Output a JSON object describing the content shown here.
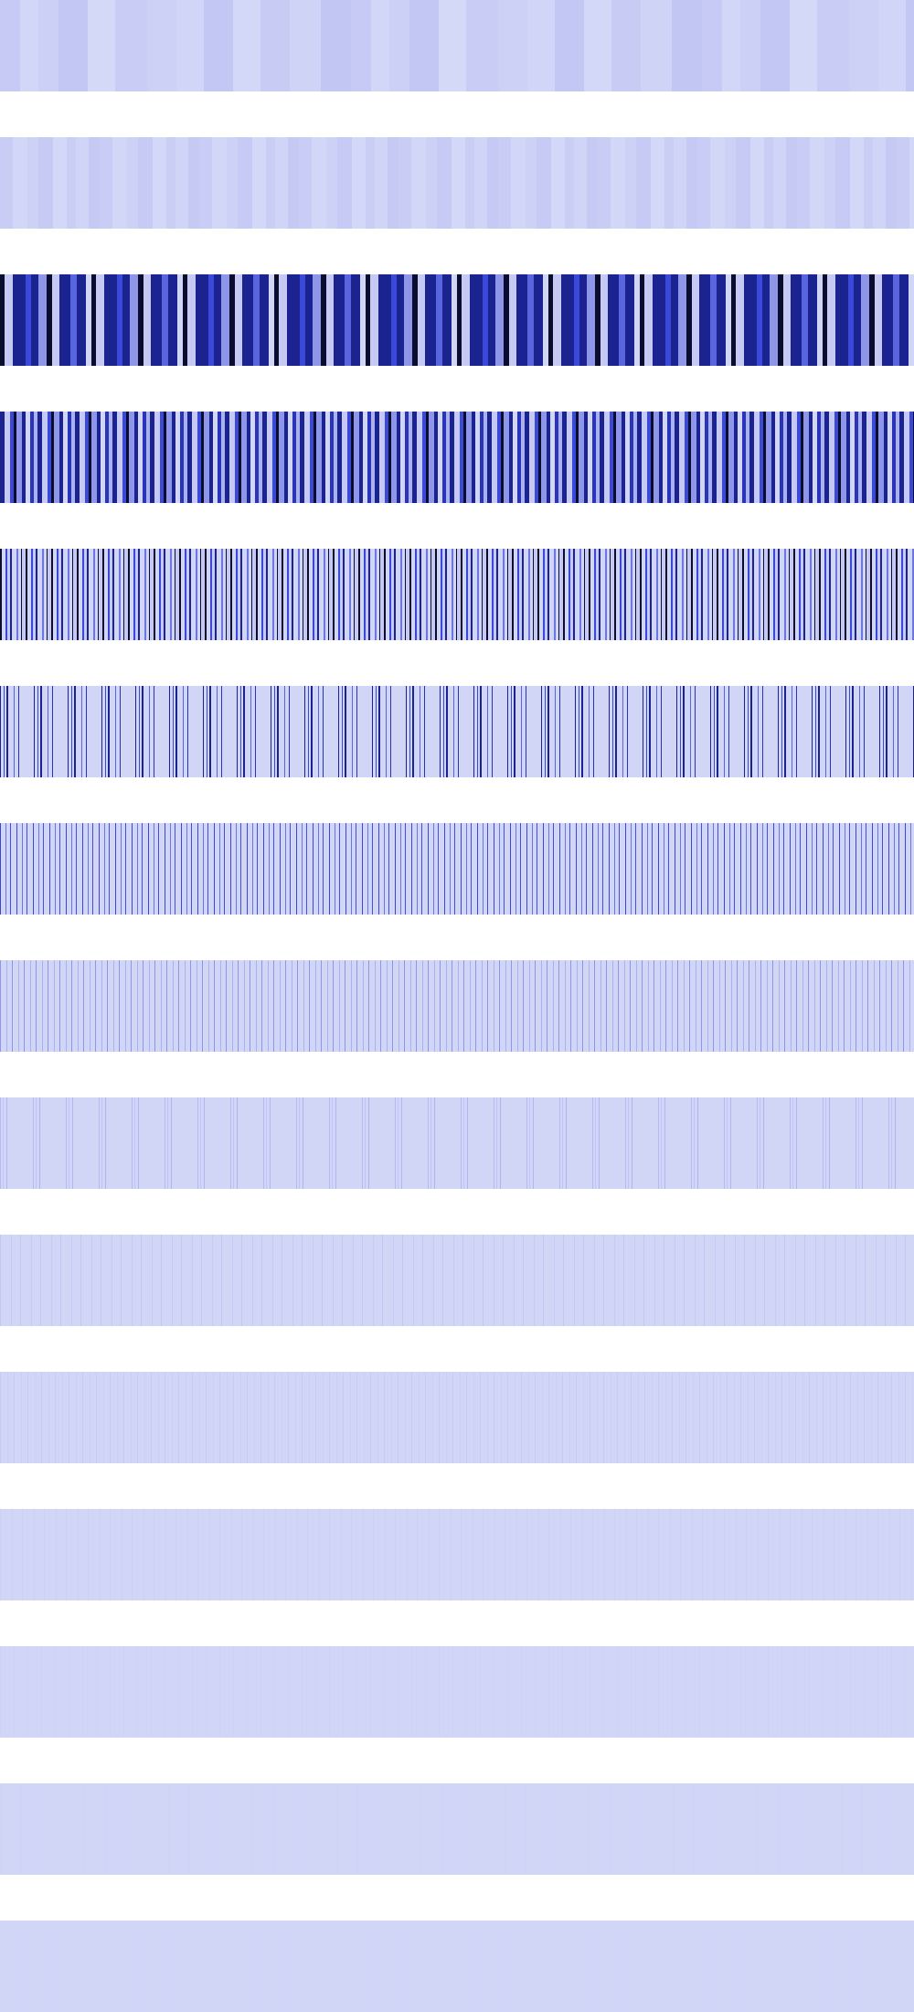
{
  "palette": {
    "background": "#ffffff",
    "base_light": "#d1d5f6",
    "lavender": "#c5c9f3",
    "periwinkle": "#8d96e8",
    "blue": "#3a49d8",
    "navy": "#1b2390",
    "near_black": "#0b0d2e"
  },
  "bands": [
    {
      "name": "band-01",
      "base": "#d1d5f6",
      "pattern": [
        [
          "#c6caf4",
          22
        ],
        [
          "#d2d6f7",
          20
        ],
        [
          "#ccd0f6",
          22
        ],
        [
          "#c3c7f3",
          32
        ],
        [
          "#d5d9f8",
          30
        ],
        [
          "#c9cdf5",
          35
        ],
        [
          "#cdd1f6",
          32
        ],
        [
          "#d1d5f7",
          30
        ],
        [
          "#c3c7f4",
          32
        ],
        [
          "#d4d8f8",
          30
        ],
        [
          "#c8ccf5",
          32
        ],
        [
          "#cfd3f6",
          34
        ],
        [
          "#c2c6f3",
          33
        ]
      ]
    },
    {
      "name": "band-02",
      "base": "#d1d5f6",
      "pattern": [
        [
          "#c9cdf5",
          14
        ],
        [
          "#d3d7f7",
          16
        ],
        [
          "#cdd1f6",
          12
        ],
        [
          "#c6caf4",
          16
        ],
        [
          "#d4d8f8",
          15
        ],
        [
          "#cacef5",
          10
        ],
        [
          "#d0d4f7",
          14
        ],
        [
          "#c5c9f3",
          12
        ]
      ]
    },
    {
      "name": "band-03",
      "base": "#d1d5f6",
      "pattern": [
        [
          "#0b0d2e",
          5
        ],
        [
          "#c5c9f3",
          9
        ],
        [
          "#1b2390",
          14
        ],
        [
          "#3a49d8",
          6
        ],
        [
          "#1b2390",
          8
        ],
        [
          "#8d96e8",
          9
        ],
        [
          "#0b0d2e",
          6
        ],
        [
          "#c5c9f3",
          8
        ],
        [
          "#1b2390",
          12
        ],
        [
          "#5865df",
          7
        ],
        [
          "#1b2390",
          10
        ],
        [
          "#d1d5f6",
          6
        ]
      ]
    },
    {
      "name": "band-04",
      "base": "#d1d5f6",
      "pattern": [
        [
          "#1b2390",
          5
        ],
        [
          "#c5c9f3",
          6
        ],
        [
          "#3a49d8",
          4
        ],
        [
          "#0b0d2e",
          3
        ],
        [
          "#8d96e8",
          6
        ],
        [
          "#1b2390",
          4
        ],
        [
          "#d1d5f6",
          5
        ],
        [
          "#2a34b8",
          4
        ],
        [
          "#aab1ef",
          4
        ]
      ]
    },
    {
      "name": "band-05",
      "base": "#d1d5f6",
      "pattern": [
        [
          "#0b0d2e",
          2
        ],
        [
          "#d1d5f6",
          4
        ],
        [
          "#3a49d8",
          2
        ],
        [
          "#c5c9f3",
          3
        ],
        [
          "#1b2390",
          2
        ],
        [
          "#d1d5f6",
          5
        ],
        [
          "#6c76e2",
          2
        ],
        [
          "#d1d5f6",
          3
        ],
        [
          "#0b0d2e",
          1
        ],
        [
          "#c5c9f3",
          4
        ]
      ]
    },
    {
      "name": "band-06",
      "base": "#d1d5f6",
      "pattern": [
        [
          "#1b2390",
          1
        ],
        [
          "#d1d5f6",
          3
        ],
        [
          "#3a49d8",
          1
        ],
        [
          "#d1d5f6",
          2
        ],
        [
          "#1b2390",
          2
        ],
        [
          "#d1d5f6",
          6
        ],
        [
          "#5865df",
          1
        ],
        [
          "#d1d5f6",
          4
        ],
        [
          "#2a34b8",
          1
        ],
        [
          "#d1d5f6",
          16
        ]
      ]
    },
    {
      "name": "band-07",
      "base": "#d1d5f6",
      "pattern": [
        [
          "#3a49d8",
          1
        ],
        [
          "#d1d5f6",
          5
        ],
        [
          "#6c76e2",
          1
        ],
        [
          "#d1d5f6",
          4
        ],
        [
          "#4250db",
          1
        ],
        [
          "#d1d5f6",
          6
        ]
      ]
    },
    {
      "name": "band-08",
      "base": "#d1d5f6",
      "pattern": [
        [
          "#8d96e8",
          1
        ],
        [
          "#d1d5f6",
          6
        ],
        [
          "#aab1ef",
          1
        ],
        [
          "#d1d5f6",
          5
        ]
      ]
    },
    {
      "name": "band-09",
      "base": "#d1d5f6",
      "pattern": [
        [
          "#b5bbf1",
          1
        ],
        [
          "#d1d5f6",
          2
        ],
        [
          "#c0c5f3",
          1
        ],
        [
          "#d1d5f6",
          3
        ],
        [
          "#b0b6f0",
          1
        ],
        [
          "#d1d5f6",
          28
        ]
      ]
    },
    {
      "name": "band-10",
      "base": "#d1d5f6",
      "pattern": [
        [
          "#c2c7f4",
          1
        ],
        [
          "#d1d5f6",
          11
        ],
        [
          "#c6cbf5",
          1
        ],
        [
          "#d1d5f6",
          9
        ]
      ]
    },
    {
      "name": "band-11",
      "base": "#d1d5f6",
      "pattern": [
        [
          "#c8ccf5",
          1
        ],
        [
          "#d1d5f6",
          7
        ],
        [
          "#cbcff6",
          1
        ],
        [
          "#d1d5f6",
          6
        ]
      ]
    },
    {
      "name": "band-12",
      "base": "#d1d5f6",
      "pattern": [
        [
          "#cccff6",
          1
        ],
        [
          "#d1d5f6",
          12
        ],
        [
          "#cdd0f6",
          1
        ],
        [
          "#d1d5f6",
          10
        ]
      ]
    },
    {
      "name": "band-13",
      "base": "#d1d5f6",
      "pattern": [
        [
          "#ced2f6",
          1
        ],
        [
          "#d1d5f6",
          14
        ]
      ]
    },
    {
      "name": "band-14",
      "base": "#d1d5f6",
      "pattern": [
        [
          "#cfd3f6",
          1
        ],
        [
          "#d1d5f6",
          22
        ]
      ]
    },
    {
      "name": "band-15",
      "base": "#d1d5f6",
      "pattern": [
        [
          "#d0d4f6",
          1
        ],
        [
          "#d1d5f6",
          30
        ]
      ]
    }
  ]
}
